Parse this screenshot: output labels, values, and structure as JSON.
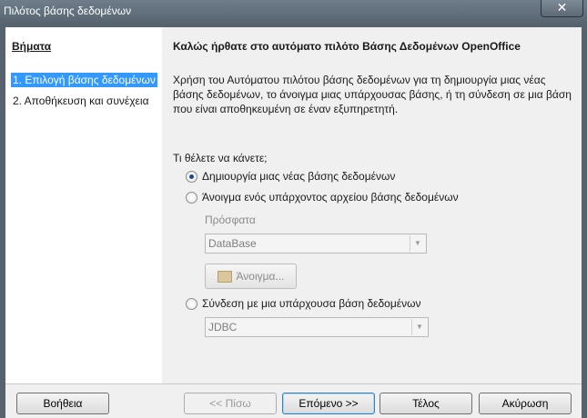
{
  "window": {
    "title": "Πιλότος βάσης δεδομένων",
    "close_glyph": "✕"
  },
  "steps": {
    "heading": "Βήματα",
    "items": [
      {
        "label": "1. Επιλογή βάσης δεδομένων",
        "selected": true
      },
      {
        "label": "2. Αποθήκευση και συνέχεια",
        "selected": false
      }
    ]
  },
  "main": {
    "heading": "Καλώς ήρθατε στο αυτόματο πιλότο Βάσης Δεδομένων OpenOffice",
    "intro": "Χρήση του Αυτόματου πιλότου βάσης δεδομένων για τη δημιουργία μιας νέας βάσης δεδομένων, το άνοιγμα μιας υπάρχουσας βάσης, ή τη σύνδεση σε μια βάση που είναι αποθηκευμένη σε έναν εξυπηρετητή.",
    "question": "Τι θέλετε να κάνετε;",
    "options": {
      "create_new": "Δημιουργία μιας νέας βάσης δεδομένων",
      "open_existing": "Άνοιγμα ενός υπάρχοντος αρχείου βάσης δεδομένων",
      "connect_existing": "Σύνδεση με μια υπάρχουσα βάση δεδομένων"
    },
    "selected_option": "create_new",
    "recent_label": "Πρόσφατα",
    "recent_value": "DataBase",
    "open_button": "Άνοιγμα...",
    "connection_value": "JDBC"
  },
  "buttons": {
    "help": "Βοήθεια",
    "back": "<< Πίσω",
    "next": "Επόμενο >>",
    "finish": "Τέλος",
    "cancel": "Ακύρωση"
  },
  "colors": {
    "selection": "#3399ff",
    "titlebar": "#5f6d7a"
  }
}
